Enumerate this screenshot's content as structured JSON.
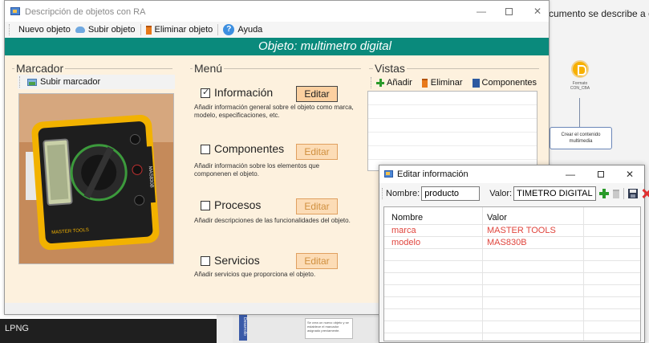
{
  "background": {
    "doc_caption": "cumento se describe a d",
    "flow_node_label": "Formato CON_CBA",
    "flow_box_text": "Crear el contenido multimedia",
    "taskbar_label": "LPNG",
    "doc_side_tab": "Desarrollo",
    "doc_note": "Se crea un nuevo objeto y se establece el marcador asignado previamente."
  },
  "window": {
    "title": "Descripción de objetos con RA",
    "minimize": "—",
    "close": "✕"
  },
  "toolbar": {
    "new_object": "Nuevo objeto",
    "upload_object": "Subir objeto",
    "delete_object": "Eliminar objeto",
    "help": "Ayuda",
    "help_glyph": "?"
  },
  "banner": {
    "title": "Objeto: multimetro digital"
  },
  "marcador": {
    "title": "Marcador",
    "upload_marker": "Subir marcador",
    "photo_model": "MAS830B",
    "photo_brand": "MASTER TOOLS"
  },
  "menu": {
    "title": "Menú",
    "items": [
      {
        "label": "Información",
        "checked": true,
        "edit": "Editar",
        "description": "Añadir información general sobre el objeto como marca, modelo, especificaciones, etc."
      },
      {
        "label": "Componentes",
        "checked": false,
        "edit": "Editar",
        "description": "Añadir información sobre los elementos que componenen el objeto."
      },
      {
        "label": "Procesos",
        "checked": false,
        "edit": "Editar",
        "description": "Añadir descripciones de las funcionalidades del objeto."
      },
      {
        "label": "Servicios",
        "checked": false,
        "edit": "Editar",
        "description": "Añadir servicios que proporciona el objeto."
      }
    ]
  },
  "vistas": {
    "title": "Vistas",
    "add": "Añadir",
    "delete": "Eliminar",
    "components": "Componentes"
  },
  "dialog": {
    "title": "Editar información",
    "minimize": "—",
    "close": "✕",
    "name_label": "Nombre:",
    "name_value": "producto",
    "value_label": "Valor:",
    "value_value": "TIMETRO DIGITAL",
    "columns": [
      "Nombre",
      "Valor"
    ],
    "rows": [
      {
        "nombre": "marca",
        "valor": "MASTER TOOLS"
      },
      {
        "nombre": "modelo",
        "valor": "MAS830B"
      }
    ]
  },
  "colors": {
    "banner": "#0a8a7c",
    "panel_bg": "#fdf1de",
    "edit_button": "#fcdcb6",
    "grid_data_text": "#e0453d"
  }
}
